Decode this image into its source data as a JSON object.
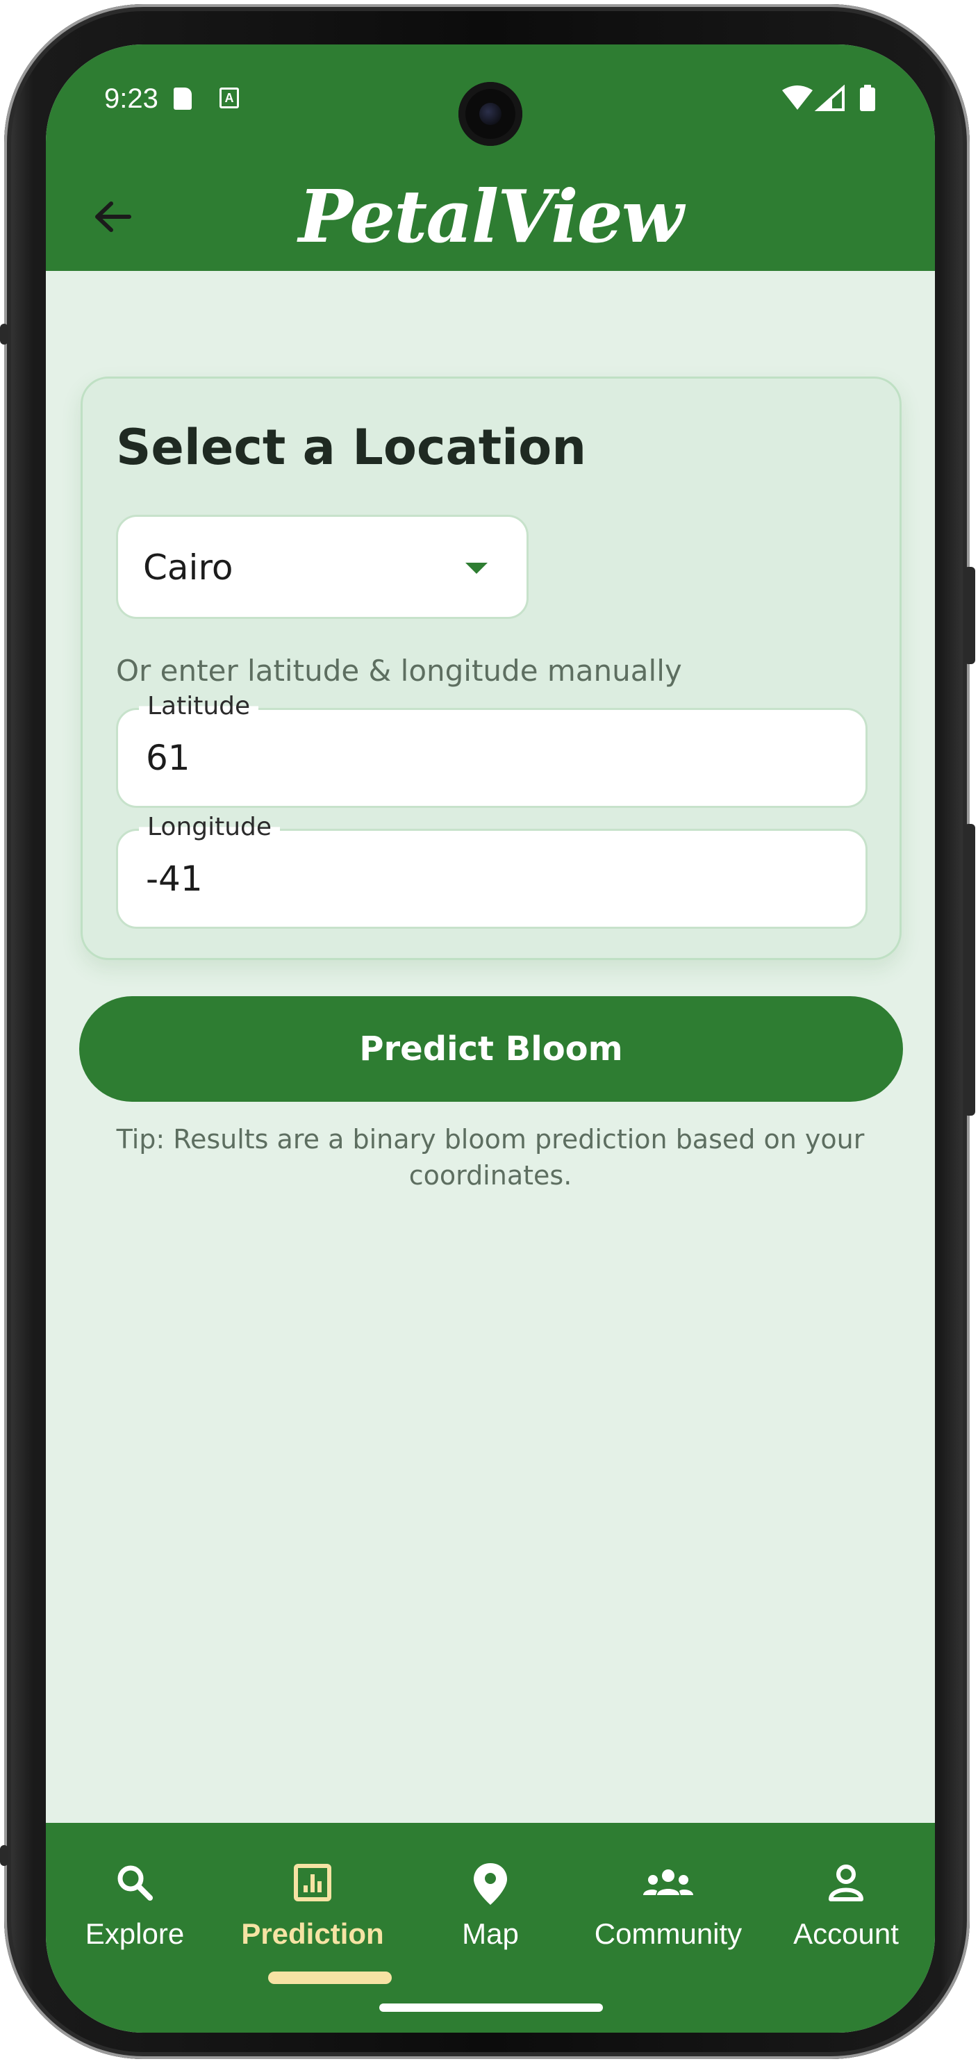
{
  "status": {
    "time": "9:23",
    "a_badge": "A"
  },
  "app": {
    "title": "PetalView"
  },
  "card": {
    "title": "Select a Location",
    "location_select": {
      "value": "Cairo"
    },
    "manual_hint": "Or enter latitude & longitude manually",
    "latitude": {
      "label": "Latitude",
      "value": "61"
    },
    "longitude": {
      "label": "Longitude",
      "value": "-41"
    }
  },
  "predict_button": {
    "label": "Predict Bloom"
  },
  "tip": "Tip: Results are a binary bloom prediction based on your coordinates.",
  "nav": {
    "items": [
      {
        "label": "Explore",
        "icon": "search-icon"
      },
      {
        "label": "Prediction",
        "icon": "chart-icon",
        "active": true
      },
      {
        "label": "Map",
        "icon": "location-pin-icon"
      },
      {
        "label": "Community",
        "icon": "people-icon"
      },
      {
        "label": "Account",
        "icon": "person-icon"
      }
    ]
  },
  "colors": {
    "primary": "#2e7d32",
    "background": "#e4f1e7",
    "card": "#dcede0",
    "active_nav": "#f6e3a4"
  }
}
